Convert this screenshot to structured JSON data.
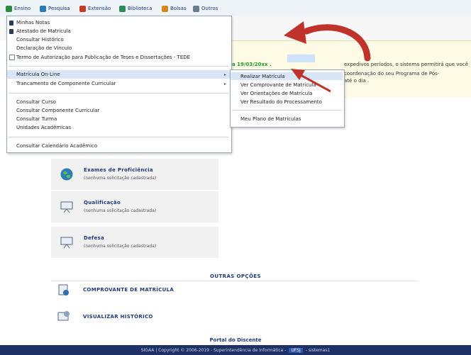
{
  "menubar": {
    "items": [
      {
        "label": "Ensino",
        "icon": "book-icon",
        "color": "#2d8a3a"
      },
      {
        "label": "Pesquisa",
        "icon": "flask-icon",
        "color": "#2b7bb9"
      },
      {
        "label": "Extensão",
        "icon": "hammer-icon",
        "color": "#c23b22"
      },
      {
        "label": "Biblioteca",
        "icon": "library-icon",
        "color": "#2e8b57"
      },
      {
        "label": "Bolsas",
        "icon": "bolsas-icon",
        "color": "#d18b1a"
      },
      {
        "label": "Outros",
        "icon": "outros-icon",
        "color": "#6b7b8c"
      }
    ]
  },
  "dropdown": {
    "items": [
      {
        "label": "Minhas Notas",
        "icon": "doc-icon"
      },
      {
        "label": "Atestado de Matrícula",
        "icon": "doc-icon"
      },
      {
        "label": "Consultar Histórico"
      },
      {
        "label": "Declaração de Vínculo"
      },
      {
        "label": "Termo de Autorização para Publicação de Teses e Dissertações - TEDE",
        "checkbox": true
      },
      {
        "label": "Matrícula On-Line",
        "submenu": true
      },
      {
        "label": "Trancamento de Componente Curricular",
        "submenu": true
      },
      {
        "label": "Consultar Curso"
      },
      {
        "label": "Consultar Componente Curricular"
      },
      {
        "label": "Consultar Turma"
      },
      {
        "label": "Unidades Acadêmicas"
      },
      {
        "label": "Consultar Calendário Acadêmico"
      }
    ],
    "submenu_arrow": "▸"
  },
  "submenu": {
    "items": [
      {
        "label": "Realizar Matrícula"
      },
      {
        "label": "Ver Comprovante de Matrícula"
      },
      {
        "label": "Ver Orientações de Matrícula"
      },
      {
        "label": "Ver Resultado do Processamento"
      },
      {
        "label": "Meu Plano de Matrículas"
      }
    ]
  },
  "notice": {
    "date_text": "a 19/03/20xx .",
    "line1": "expedivos períodos, o sistema permitirá que você",
    "line2": "coordenação do seu Programa de Pós-",
    "line3": "até o dia ."
  },
  "cards": [
    {
      "title": "Exames de Proficiência",
      "subtitle": "(nenhuma solicitação cadastrada)",
      "icon": "globe-icon"
    },
    {
      "title": "Qualificação",
      "subtitle": "(nenhuma solicitação cadastrada)",
      "icon": "presentation-icon"
    },
    {
      "title": "Defesa",
      "subtitle": "(nenhuma solicitação cadastrada)",
      "icon": "presentation-icon"
    }
  ],
  "other_options": {
    "title": "Outras opções",
    "items": [
      {
        "label": "Comprovante de Matrícula",
        "icon": "certificate-icon"
      },
      {
        "label": "Visualizar Histórico",
        "icon": "history-icon"
      }
    ]
  },
  "portal": "Portal do Discente",
  "footer": {
    "text": "SIGAA | Copyright © 2006-2019 - Superintendência de Informática -",
    "badge": "UFSJ",
    "suffix": "- sistemas1"
  },
  "colors": {
    "accent": "#1d3a7a",
    "arrow": "#c0332b",
    "notice_date": "#1c9a22"
  }
}
